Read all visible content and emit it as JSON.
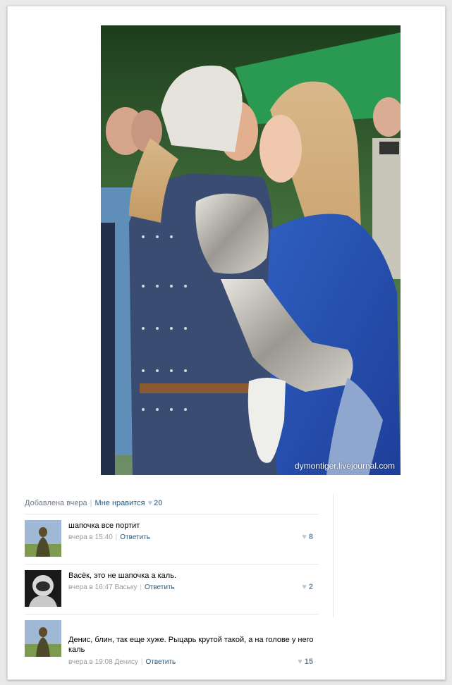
{
  "photo": {
    "watermark": "dymontiger.livejournal.com"
  },
  "post_meta": {
    "added": "Добавлена вчера",
    "like_label": "Мне нравится",
    "like_icon": "heart-icon",
    "like_count": "20"
  },
  "comments": [
    {
      "text": "шапочка все портит",
      "time": "вчера в 15:40",
      "addressee": "",
      "reply_label": "Ответить",
      "likes": "8",
      "avatar_icon": "soldier-avatar"
    },
    {
      "text": "Васёк, это не шапочка а каль.",
      "time": "вчера в 16:47",
      "addressee": "Ваську",
      "reply_label": "Ответить",
      "likes": "2",
      "avatar_icon": "astronaut-avatar"
    },
    {
      "text": "Денис, блин, так еще хуже. Рыцарь крутой такой, а на голове у него каль",
      "time": "вчера в 19:08",
      "addressee": "Денису",
      "reply_label": "Ответить",
      "likes": "15",
      "avatar_icon": "soldier-avatar"
    }
  ],
  "colors": {
    "link": "#2b587a",
    "muted": "#999999",
    "heart": "#b7c8d8"
  }
}
